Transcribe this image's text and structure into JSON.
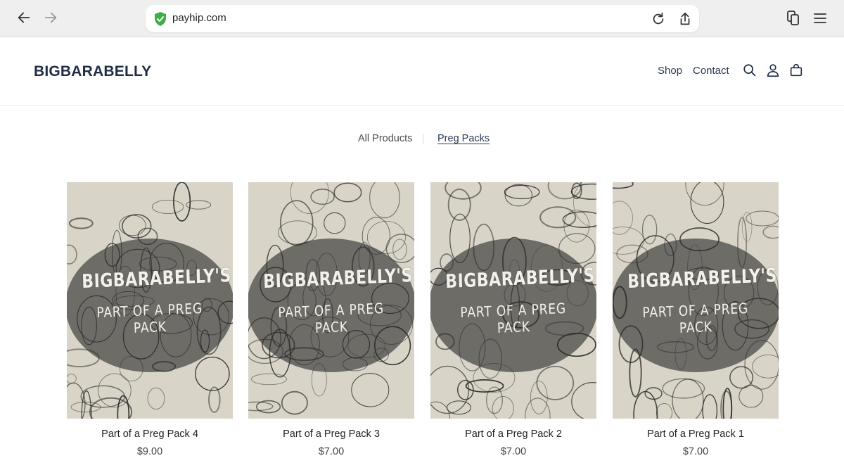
{
  "browser": {
    "url": "payhip.com",
    "icons": {
      "back": "arrow-left-icon",
      "forward": "arrow-right-icon",
      "secure": "shield-check-icon",
      "reload": "reload-icon",
      "share": "share-icon",
      "tabs": "tabs-icon",
      "menu": "menu-icon"
    },
    "colors": {
      "shield": "#3fae49"
    }
  },
  "site": {
    "brand": "BIGBARABELLY",
    "nav": {
      "shop": "Shop",
      "contact": "Contact"
    },
    "icons": {
      "search": "search-icon",
      "account": "user-icon",
      "cart": "bag-icon"
    },
    "colors": {
      "brand": "#1f2d45"
    }
  },
  "filters": {
    "all": "All Products",
    "active": "Preg Packs"
  },
  "products": [
    {
      "cover_title": "BIGBARABELLY'S",
      "cover_sub": "PART OF A PREG PACK",
      "name": "Part of a Preg Pack 4",
      "price": "$9.00"
    },
    {
      "cover_title": "BIGBARABELLY'S",
      "cover_sub": "PART OF A PREG PACK",
      "name": "Part of a Preg Pack 3",
      "price": "$7.00"
    },
    {
      "cover_title": "BIGBARABELLY'S",
      "cover_sub": "PART OF A PREG PACK",
      "name": "Part of a Preg Pack 2",
      "price": "$7.00"
    },
    {
      "cover_title": "BIGBARABELLY'S",
      "cover_sub": "PART OF A PREG PACK",
      "name": "Part of a Preg Pack 1",
      "price": "$7.00"
    }
  ]
}
